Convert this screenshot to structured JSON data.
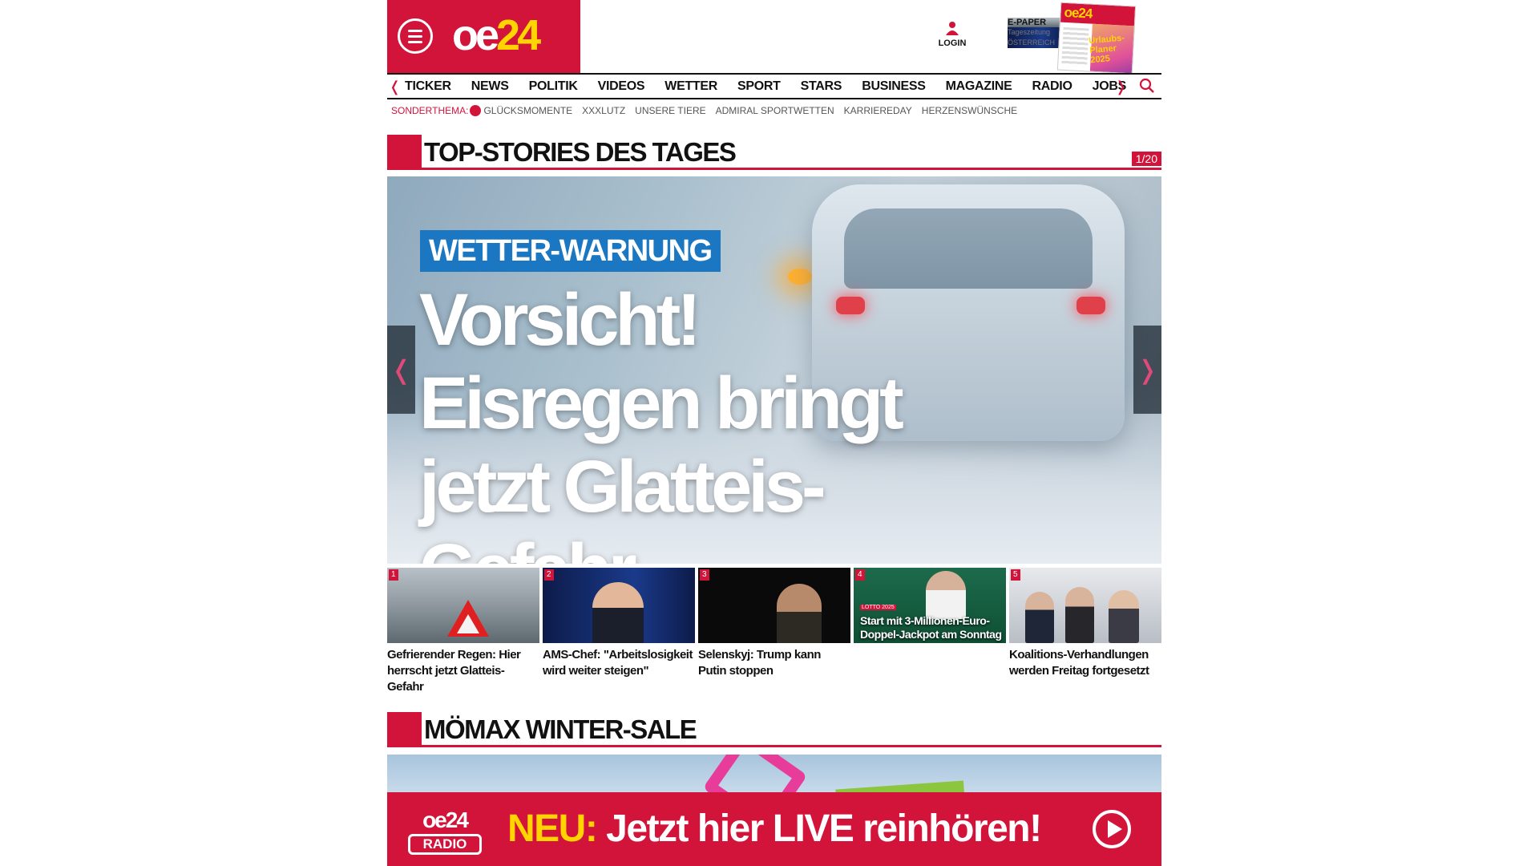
{
  "header": {
    "logo_oe": "oe",
    "logo_24": "24",
    "login_label": "LOGIN",
    "epaper_title": "E-PAPER",
    "epaper_line1": "Tageszeitung",
    "epaper_line2": "ÖSTERREICH",
    "cover_logo": "oe24",
    "cover_text": "Urlaubs-Planer 2025"
  },
  "nav": {
    "items": [
      "TICKER",
      "NEWS",
      "POLITIK",
      "VIDEOS",
      "WETTER",
      "SPORT",
      "STARS",
      "BUSINESS",
      "MAGAZINE",
      "RADIO",
      "JOBS"
    ]
  },
  "sonderthema": {
    "title": "SONDERTHEMA:",
    "items": [
      "GLÜCKSMOMENTE",
      "XXXLUTZ",
      "UNSERE TIERE",
      "ADMIRAL SPORTWETTEN",
      "KARRIEREDAY",
      "HERZENSWÜNSCHE"
    ]
  },
  "top_stories": {
    "title": "TOP-STORIES DES TAGES",
    "counter": "1/20",
    "hero": {
      "kicker": "WETTER-WARNUNG",
      "headline_1": "Vorsicht!",
      "headline_2": "Eisregen bringt",
      "headline_3": "jetzt Glatteis-Gefahr"
    },
    "stories": [
      {
        "num": "1",
        "caption": "Gefrierender Regen: Hier herrscht jetzt Glatteis-Gefahr"
      },
      {
        "num": "2",
        "caption": "AMS-Chef: \"Arbeitslosigkeit wird weiter steigen\""
      },
      {
        "num": "3",
        "caption": "Selenskyj: Trump kann Putin stoppen"
      },
      {
        "num": "4",
        "caption": "",
        "overlay": "Start mit 3-Millionen-Euro-Doppel-Jackpot am Sonntag",
        "badge": "LOTTO 2025"
      },
      {
        "num": "5",
        "caption": "Koalitions-Verhandlungen werden Freitag fortgesetzt"
      }
    ]
  },
  "section2": {
    "title": "MÖMAX WINTER-SALE"
  },
  "radio_banner": {
    "logo": "oe24",
    "logo_box": "RADIO",
    "neu": "NEU:",
    "text": "Jetzt hier LIVE reinhören!"
  },
  "colors": {
    "brand_red": "#d2143a",
    "brand_yellow": "#ffd400",
    "kicker_blue": "#1c77c3"
  }
}
